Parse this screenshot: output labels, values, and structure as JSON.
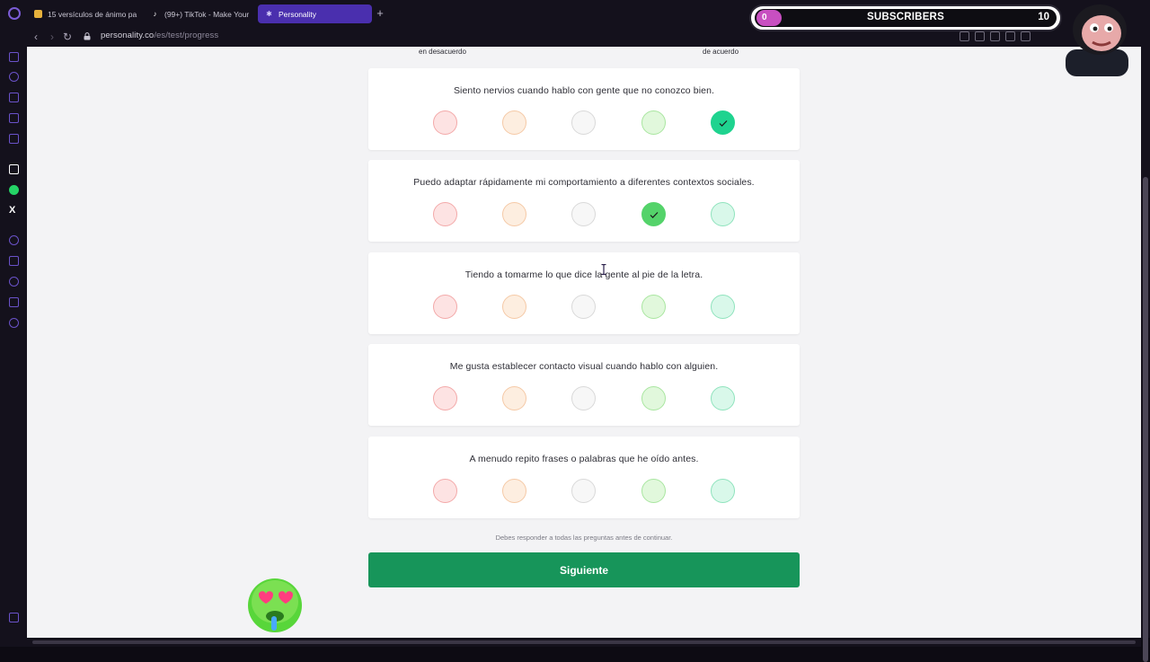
{
  "browser": {
    "tabs": [
      {
        "label": "15 versículos de ánimo pa",
        "active": false
      },
      {
        "label": "(99+) TikTok - Make Your",
        "active": false
      },
      {
        "label": "Personality",
        "active": true
      }
    ],
    "url_host": "personality.co",
    "url_path": "/es/test/progress"
  },
  "scale": {
    "left_label": "en desacuerdo",
    "right_label": "de acuerdo"
  },
  "questions": [
    {
      "text": "Siento nervios cuando hablo con gente que no conozco bien.",
      "selected": 5
    },
    {
      "text": "Puedo adaptar rápidamente mi comportamiento a diferentes contextos sociales.",
      "selected": 4
    },
    {
      "text": "Tiendo a tomarme lo que dice la gente al pie de la letra.",
      "selected": null
    },
    {
      "text": "Me gusta establecer contacto visual cuando hablo con alguien.",
      "selected": null
    },
    {
      "text": "A menudo repito frases o palabras que he oído antes.",
      "selected": null
    }
  ],
  "notice": "Debes responder a todas las preguntas antes de continuar.",
  "next_button": "Siguiente",
  "overlay": {
    "subs_current": "0",
    "subs_label": "SUBSCRIBERS",
    "subs_goal": "10"
  },
  "colors": {
    "accent_purple": "#4a2fae",
    "next_button": "#17955a",
    "selected_agree": "#54d36a",
    "selected_strong_agree": "#1fd38f"
  }
}
